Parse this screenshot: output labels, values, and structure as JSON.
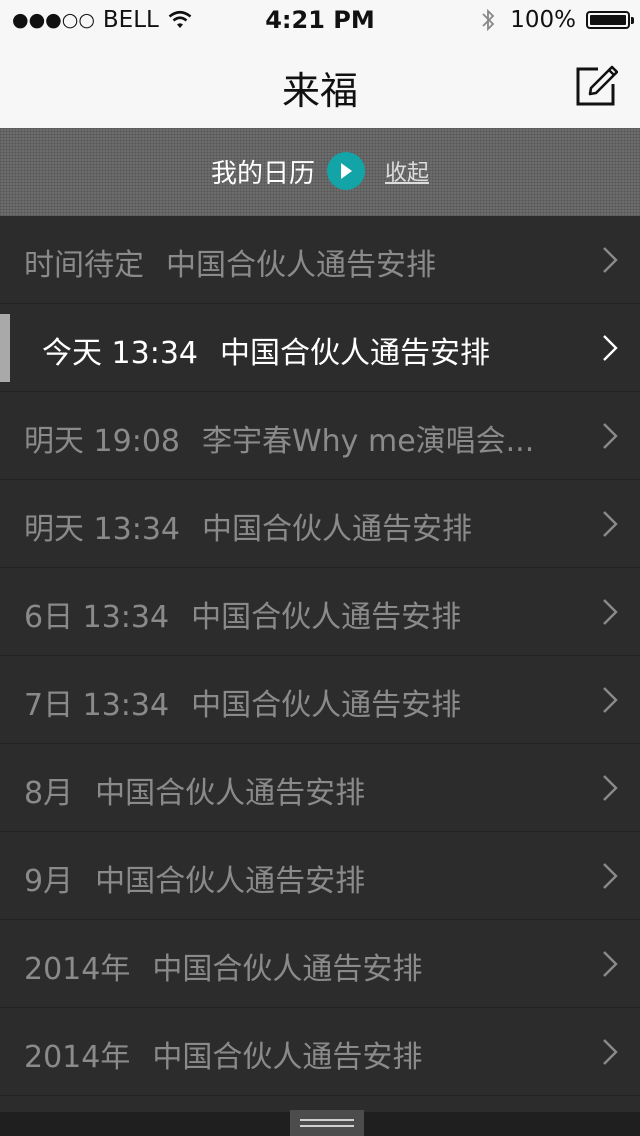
{
  "status_bar": {
    "signal": "●●●○○",
    "carrier": "BELL",
    "time": "4:21 PM",
    "battery": "100%"
  },
  "nav": {
    "title": "来福"
  },
  "banner": {
    "title": "我的日历",
    "collapse": "收起",
    "accent_color": "#13a4a7"
  },
  "events": [
    {
      "when": "时间待定",
      "title": "中国合伙人通告安排",
      "active": false
    },
    {
      "when": "今天 13:34",
      "title": "中国合伙人通告安排",
      "active": true
    },
    {
      "when": "明天 19:08",
      "title": "李宇春Why me演唱会...",
      "active": false
    },
    {
      "when": "明天 13:34",
      "title": "中国合伙人通告安排",
      "active": false
    },
    {
      "when": "6日 13:34",
      "title": "中国合伙人通告安排",
      "active": false
    },
    {
      "when": "7日 13:34",
      "title": "中国合伙人通告安排",
      "active": false
    },
    {
      "when": "8月",
      "title": "中国合伙人通告安排",
      "active": false
    },
    {
      "when": "9月",
      "title": "中国合伙人通告安排",
      "active": false
    },
    {
      "when": "2014年",
      "title": "中国合伙人通告安排",
      "active": false
    },
    {
      "when": "2014年",
      "title": "中国合伙人通告安排",
      "active": false
    }
  ]
}
